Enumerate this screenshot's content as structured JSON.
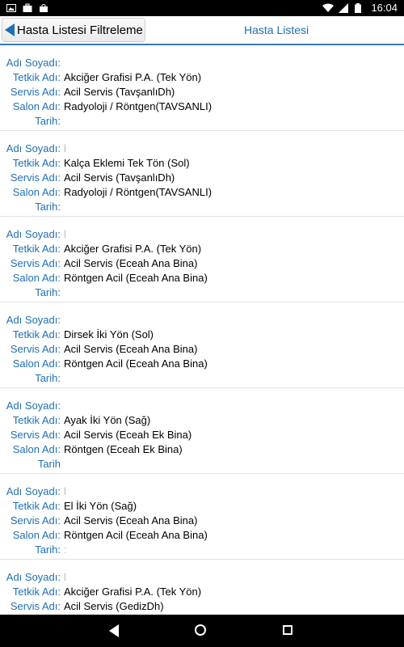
{
  "status_bar": {
    "time": "16:04",
    "icons": [
      "image-icon",
      "briefcase-icon",
      "shopping-bag-icon",
      "wifi-icon",
      "signal-icon",
      "battery-icon"
    ]
  },
  "header": {
    "back_label": "Hasta Listesi Filtreleme",
    "title": "Hasta Listesi"
  },
  "labels": {
    "name": "Adı Soyadı:",
    "test": "Tetkik Adı:",
    "service": "Servis Adı:",
    "room": "Salon Adı:",
    "date": "Tarih:",
    "date_nocolon": "Tarih"
  },
  "patients": [
    {
      "name": "",
      "test": "Akciğer Grafisi P.A. (Tek Yön)",
      "service": "Acil Servis (TavşanlıDh)",
      "room": "Radyoloji / Röntgen(TAVSANLI)",
      "date": ""
    },
    {
      "name": "l",
      "test": "Kalça Eklemi Tek Tön (Sol)",
      "service": "Acil Servis (TavşanlıDh)",
      "room": "Radyoloji / Röntgen(TAVSANLI)",
      "date": ""
    },
    {
      "name": "l",
      "test": "Akciğer Grafisi P.A. (Tek Yön)",
      "service": "Acil Servis (Eceah Ana Bina)",
      "room": "Röntgen Acil (Eceah Ana Bina)",
      "date": ""
    },
    {
      "name": "",
      "test": "Dirsek İki Yön (Sol)",
      "service": "Acil Servis (Eceah Ana Bina)",
      "room": "Röntgen Acil (Eceah Ana Bina)",
      "date": ""
    },
    {
      "name": "",
      "test": "Ayak İki Yön (Sağ)",
      "service": "Acil Servis (Eceah Ek Bina)",
      "room": "Röntgen (Eceah Ek Bina)",
      "date": ""
    },
    {
      "name": "l",
      "test": "El İki Yön (Sağ)",
      "service": "Acil Servis (Eceah Ana Bina)",
      "room": "Röntgen Acil (Eceah Ana Bina)",
      "date": ":"
    },
    {
      "name": "l",
      "test": "Akciğer Grafisi P.A. (Tek Yön)",
      "service": "Acil Servis (GedizDh)",
      "room": "",
      "date": ""
    }
  ]
}
